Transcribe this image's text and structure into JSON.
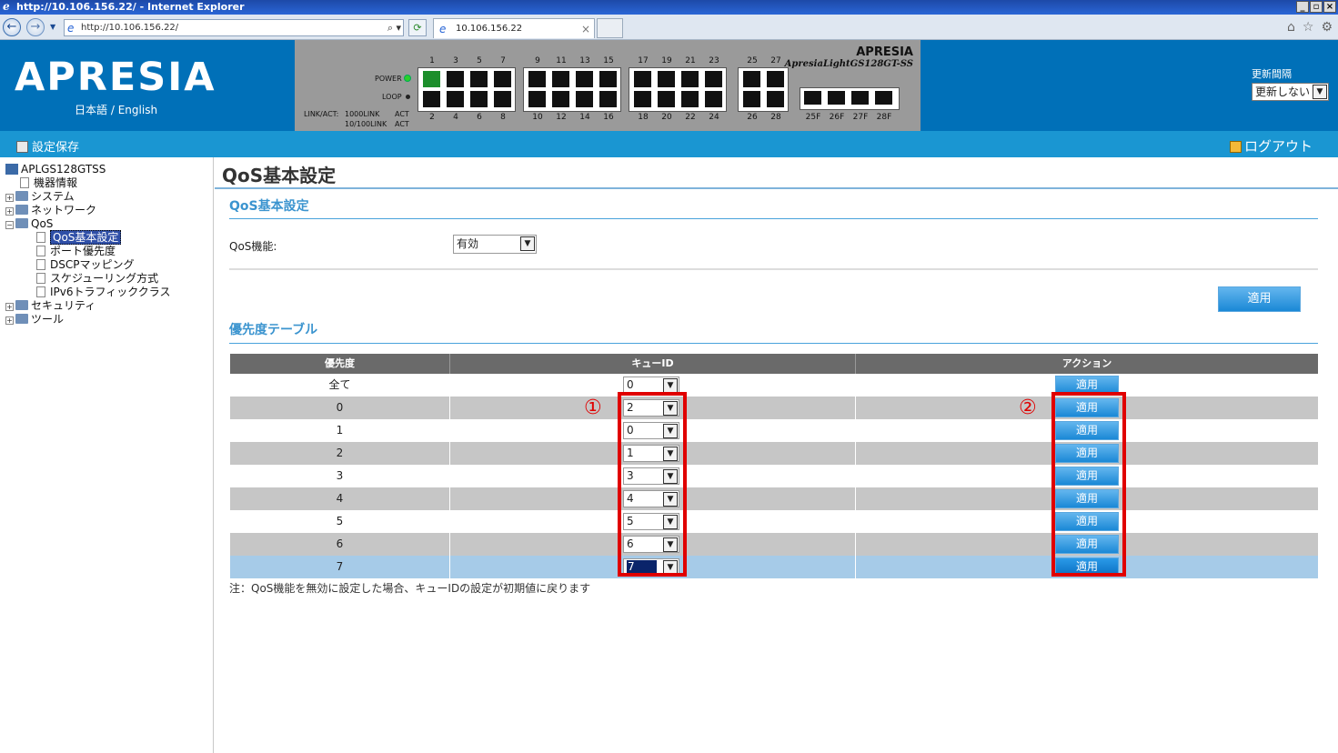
{
  "browser": {
    "title": "http://10.106.156.22/ - Internet Explorer",
    "address": "http://10.106.156.22/",
    "tab_title": "10.106.156.22"
  },
  "header": {
    "logo": "APRESIA",
    "lang_ja": "日本語",
    "lang_sep": "/",
    "lang_en": "English",
    "brand_top": "APRESIA",
    "brand_model": "ApresiaLightGS128GT-SS",
    "power_label": "POWER",
    "loop_label": "LOOP",
    "linkact_label": "LINK/ACT:",
    "link1000_label": "1000LINK",
    "link100_label": "10/100LINK",
    "act_label": "ACT",
    "ports_top": [
      "1",
      "3",
      "5",
      "7",
      "9",
      "11",
      "13",
      "15",
      "17",
      "19",
      "21",
      "23",
      "25",
      "27"
    ],
    "ports_bottom": [
      "2",
      "4",
      "6",
      "8",
      "10",
      "12",
      "14",
      "16",
      "18",
      "20",
      "22",
      "24",
      "26",
      "28"
    ],
    "sfp_labels": [
      "25F",
      "26F",
      "27F",
      "28F"
    ],
    "refresh_label": "更新間隔",
    "refresh_value": "更新しない"
  },
  "menubar": {
    "save": "設定保存",
    "logout": "ログアウト"
  },
  "tree": {
    "root": "APLGS128GTSS",
    "items": [
      {
        "label": "機器情報"
      },
      {
        "label": "システム"
      },
      {
        "label": "ネットワーク"
      },
      {
        "label": "QoS"
      },
      {
        "label": "QoS基本設定"
      },
      {
        "label": "ポート優先度"
      },
      {
        "label": "DSCPマッピング"
      },
      {
        "label": "スケジューリング方式"
      },
      {
        "label": "IPv6トラフィッククラス"
      },
      {
        "label": "セキュリティ"
      },
      {
        "label": "ツール"
      }
    ]
  },
  "main": {
    "page_title": "QoS基本設定",
    "section1": "QoS基本設定",
    "qos_label": "QoS機能:",
    "qos_value": "有効",
    "apply": "適用",
    "section2": "優先度テーブル",
    "columns": [
      "優先度",
      "キューID",
      "アクション"
    ],
    "rows": [
      {
        "priority": "全て",
        "queue": "0",
        "action": "適用"
      },
      {
        "priority": "0",
        "queue": "2",
        "action": "適用"
      },
      {
        "priority": "1",
        "queue": "0",
        "action": "適用"
      },
      {
        "priority": "2",
        "queue": "1",
        "action": "適用"
      },
      {
        "priority": "3",
        "queue": "3",
        "action": "適用"
      },
      {
        "priority": "4",
        "queue": "4",
        "action": "適用"
      },
      {
        "priority": "5",
        "queue": "5",
        "action": "適用"
      },
      {
        "priority": "6",
        "queue": "6",
        "action": "適用"
      },
      {
        "priority": "7",
        "queue": "7",
        "action": "適用"
      }
    ],
    "note": "注：QoS機能を無効に設定した場合、キューIDの設定が初期値に戻ります"
  },
  "annotations": {
    "marker1": "①",
    "marker2": "②",
    "color": "#e00000"
  }
}
